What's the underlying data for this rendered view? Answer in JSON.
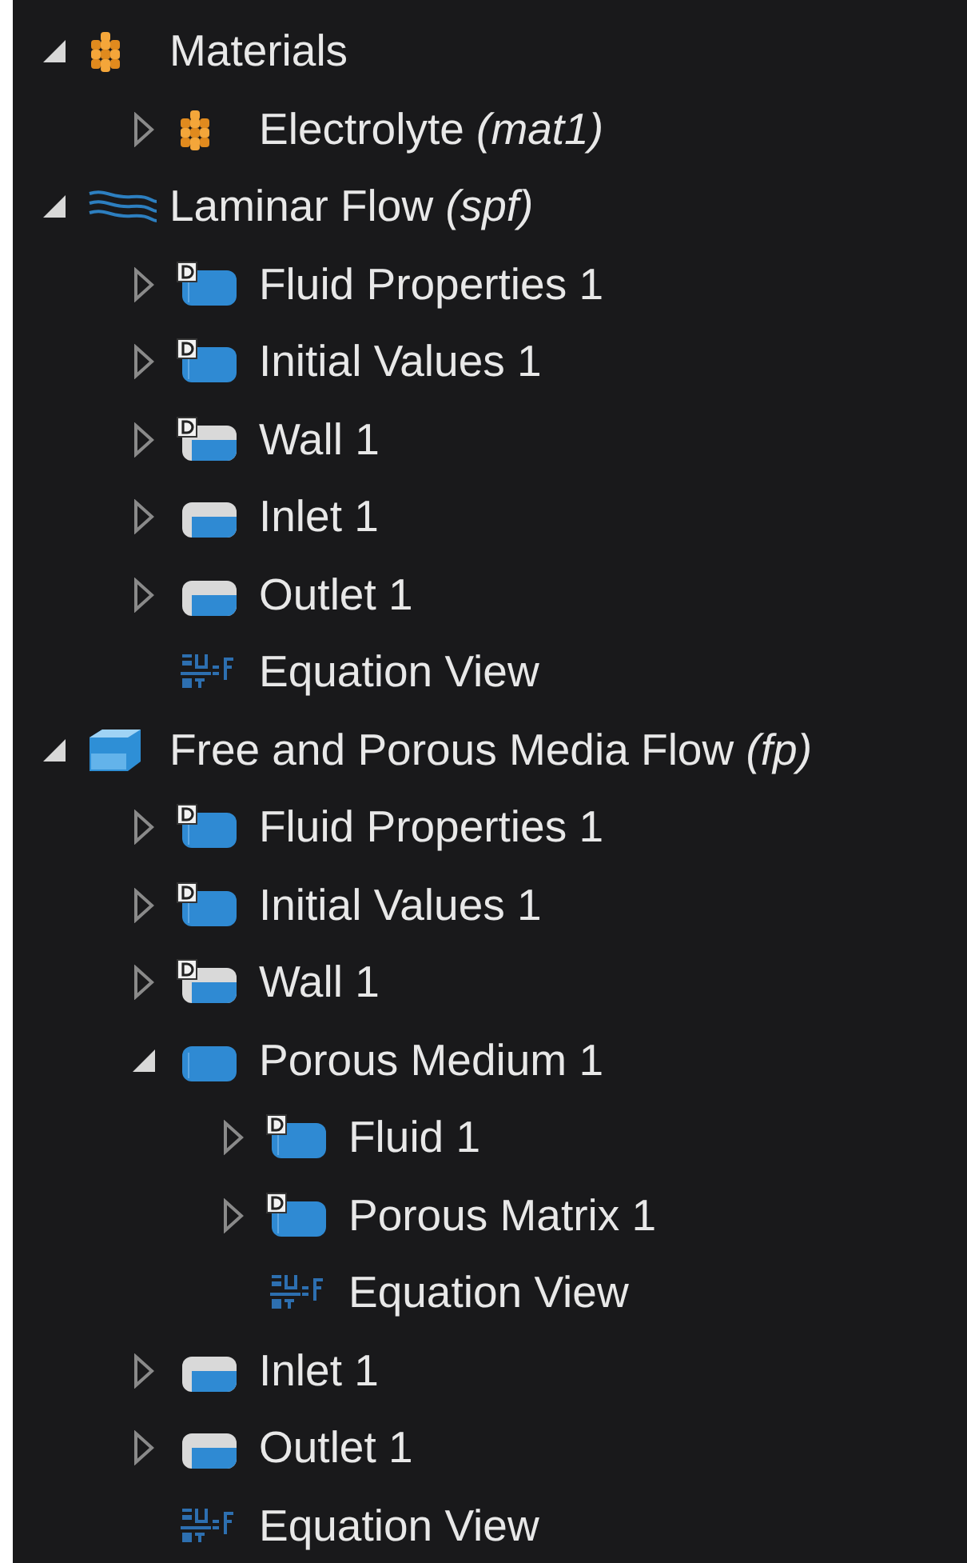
{
  "tree": [
    {
      "label": "Materials",
      "kind": "materials",
      "expanded": true,
      "children": [
        {
          "label": "Electrolyte *(mat1)*",
          "kind": "materials",
          "expanded": false
        }
      ]
    },
    {
      "label": "Laminar Flow *(spf)*",
      "kind": "laminar",
      "expanded": true,
      "children": [
        {
          "label": "Fluid Properties 1",
          "kind": "domain-default",
          "expanded": false
        },
        {
          "label": "Initial Values 1",
          "kind": "domain-default",
          "expanded": false
        },
        {
          "label": "Wall 1",
          "kind": "boundary-default",
          "expanded": false
        },
        {
          "label": "Inlet 1",
          "kind": "boundary",
          "expanded": false
        },
        {
          "label": "Outlet 1",
          "kind": "boundary",
          "expanded": false
        },
        {
          "label": "Equation View",
          "kind": "equation"
        }
      ]
    },
    {
      "label": "Free and Porous Media Flow *(fp)*",
      "kind": "physics-block",
      "expanded": true,
      "children": [
        {
          "label": "Fluid Properties 1",
          "kind": "domain-default",
          "expanded": false
        },
        {
          "label": "Initial Values 1",
          "kind": "domain-default",
          "expanded": false
        },
        {
          "label": "Wall 1",
          "kind": "boundary-default",
          "expanded": false
        },
        {
          "label": "Porous Medium 1",
          "kind": "domain",
          "expanded": true,
          "children": [
            {
              "label": "Fluid 1",
              "kind": "domain-default",
              "expanded": false
            },
            {
              "label": "Porous Matrix 1",
              "kind": "domain-default",
              "expanded": false
            },
            {
              "label": "Equation View",
              "kind": "equation"
            }
          ]
        },
        {
          "label": "Inlet 1",
          "kind": "boundary",
          "expanded": false
        },
        {
          "label": "Outlet 1",
          "kind": "boundary",
          "expanded": false
        },
        {
          "label": "Equation View",
          "kind": "equation"
        }
      ]
    }
  ]
}
